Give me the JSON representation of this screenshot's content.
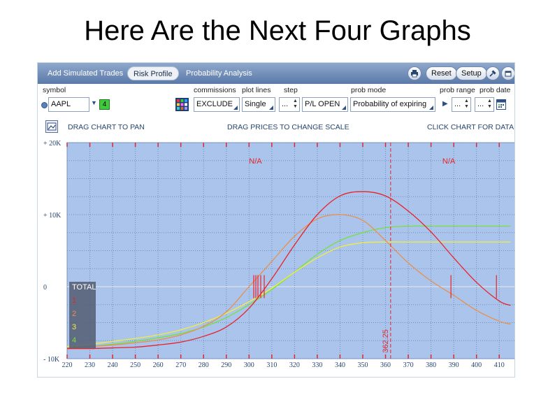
{
  "slide": {
    "title": "Here Are the Next Four Graphs"
  },
  "tabs": [
    {
      "label": "Add Simulated Trades",
      "active": false
    },
    {
      "label": "Risk Profile",
      "active": true
    },
    {
      "label": "Probability Analysis",
      "active": false
    }
  ],
  "toolbar": {
    "reset_label": "Reset",
    "setup_label": "Setup",
    "print_icon": "printer-icon",
    "pin_icon": "pin-icon",
    "detach_icon": "detach-window-icon"
  },
  "controls": {
    "symbol_label": "symbol",
    "symbol_value": "AAPL",
    "symbol_badge": "4",
    "commissions_label": "commissions",
    "commissions_value": "EXCLUDE",
    "plotlines_label": "plot lines",
    "plotlines_value": "Single",
    "step_label": "step",
    "step_value": "...",
    "pl_value": "P/L OPEN",
    "probmode_label": "prob mode",
    "probmode_value": "Probability of expiring",
    "probrange_label": "prob range",
    "probrange_value": "...",
    "probdate_label": "prob date",
    "probdate_value": "..."
  },
  "chart_hints": {
    "pan": "DRAG CHART TO PAN",
    "scale": "DRAG PRICES TO CHANGE SCALE",
    "data": "CLICK CHART FOR DATA"
  },
  "colors": {
    "plot_bg": "#aac4ec",
    "total": "#e8232a",
    "series1": "#e8232a",
    "series2": "#e89050",
    "series3": "#f0ee40",
    "series4": "#74e23a",
    "accent": "#e8232a"
  },
  "chart_data": {
    "type": "line",
    "x": [
      220,
      230,
      240,
      250,
      260,
      270,
      280,
      290,
      300,
      310,
      320,
      330,
      340,
      350,
      360,
      370,
      380,
      390,
      400,
      410,
      415
    ],
    "xtick_labels": [
      "220",
      "230",
      "240",
      "250",
      "260",
      "270",
      "280",
      "290",
      "300",
      "310",
      "320",
      "330",
      "340",
      "350",
      "360",
      "370",
      "380",
      "390",
      "400",
      "410"
    ],
    "ytick_labels": [
      "+ 20K",
      "+ 10K",
      "0",
      "- 10K"
    ],
    "ytick_values": [
      20000,
      10000,
      0,
      -10000
    ],
    "xlim": [
      220,
      417
    ],
    "ylim": [
      -10000,
      20000
    ],
    "grid": true,
    "current_price": 362.25,
    "current_price_label": "362.25",
    "na_labels": [
      "N/A",
      "N/A"
    ],
    "na_x": [
      300,
      385
    ],
    "legend": [
      "TOTAL",
      "1",
      "2",
      "3",
      "4"
    ],
    "series": [
      {
        "name": "1",
        "color": "#e8232a",
        "values": [
          -8600,
          -8600,
          -8500,
          -8400,
          -8100,
          -7700,
          -6900,
          -5600,
          -3000,
          1100,
          5800,
          10000,
          12600,
          13200,
          12600,
          10500,
          7600,
          4000,
          600,
          -2000,
          -2600
        ]
      },
      {
        "name": "2",
        "color": "#e89050",
        "values": [
          -8500,
          -8300,
          -8100,
          -7800,
          -7400,
          -6700,
          -5500,
          -3500,
          0,
          3500,
          7000,
          9400,
          10000,
          9200,
          6400,
          3300,
          800,
          -1200,
          -3300,
          -4800,
          -5200
        ]
      },
      {
        "name": "3",
        "color": "#f0ee40",
        "values": [
          -8300,
          -8000,
          -7600,
          -7200,
          -6700,
          -6000,
          -5000,
          -3700,
          -2100,
          -200,
          2000,
          4000,
          5500,
          6100,
          6200,
          6200,
          6200,
          6200,
          6200,
          6200,
          6200
        ]
      },
      {
        "name": "4",
        "color": "#74e23a",
        "values": [
          -8600,
          -8300,
          -8000,
          -7600,
          -7100,
          -6500,
          -5600,
          -4300,
          -2500,
          -400,
          2000,
          4500,
          6400,
          7500,
          8200,
          8400,
          8400,
          8400,
          8400,
          8400,
          8400
        ]
      }
    ]
  }
}
